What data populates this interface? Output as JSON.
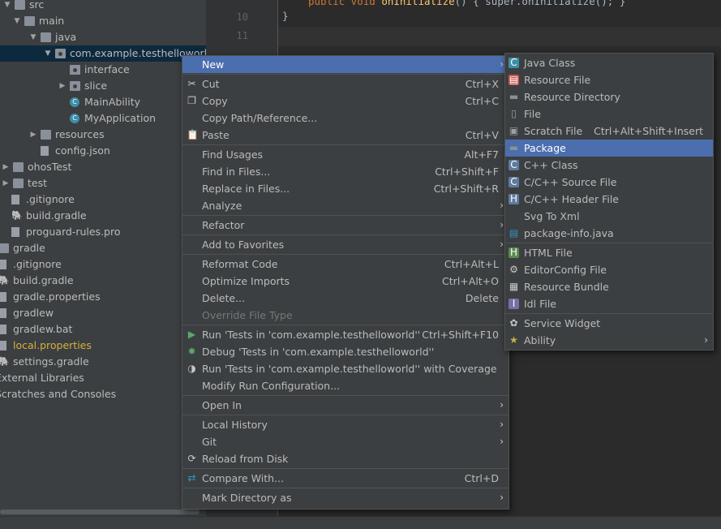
{
  "tree": {
    "items": [
      {
        "label": "src",
        "icon": "folder-icon",
        "arrow": "down"
      },
      {
        "label": "main",
        "icon": "folder-icon",
        "arrow": "down"
      },
      {
        "label": "java",
        "icon": "folder-icon",
        "arrow": "down"
      },
      {
        "label": "com.example.testhelloworld",
        "icon": "package-icon",
        "arrow": "down",
        "selected": true
      },
      {
        "label": "interface",
        "icon": "package-icon",
        "arrow": ""
      },
      {
        "label": "slice",
        "icon": "package-icon",
        "arrow": "right"
      },
      {
        "label": "MainAbility",
        "icon": "class-icon",
        "arrow": ""
      },
      {
        "label": "MyApplication",
        "icon": "class-icon",
        "arrow": ""
      },
      {
        "label": "resources",
        "icon": "folder-icon",
        "arrow": "right"
      },
      {
        "label": "config.json",
        "icon": "json-file-icon",
        "arrow": ""
      },
      {
        "label": "ohosTest",
        "icon": "folder-icon",
        "arrow": "right"
      },
      {
        "label": "test",
        "icon": "folder-icon",
        "arrow": "right"
      },
      {
        "label": ".gitignore",
        "icon": "gitignore-file-icon",
        "arrow": ""
      },
      {
        "label": "build.gradle",
        "icon": "gradle-icon",
        "arrow": ""
      },
      {
        "label": "proguard-rules.pro",
        "icon": "file-icon",
        "arrow": ""
      },
      {
        "label": "gradle",
        "icon": "folder-icon",
        "arrow": "right"
      },
      {
        "label": ".gitignore",
        "icon": "gitignore-file-icon",
        "arrow": ""
      },
      {
        "label": "build.gradle",
        "icon": "gradle-icon",
        "arrow": ""
      },
      {
        "label": "gradle.properties",
        "icon": "properties-file-icon",
        "arrow": ""
      },
      {
        "label": "gradlew",
        "icon": "file-icon",
        "arrow": ""
      },
      {
        "label": "gradlew.bat",
        "icon": "file-icon",
        "arrow": ""
      },
      {
        "label": "local.properties",
        "icon": "properties-file-icon",
        "arrow": "",
        "warn": true
      },
      {
        "label": "settings.gradle",
        "icon": "gradle-icon",
        "arrow": ""
      },
      {
        "label": "External Libraries",
        "icon": "library-icon",
        "arrow": "right"
      },
      {
        "label": "Scratches and Consoles",
        "icon": "scratch-icon",
        "arrow": "right"
      }
    ]
  },
  "editor": {
    "line_numbers": [
      "10",
      "11"
    ],
    "line_top_kw": "public void",
    "line_top_fn": "onInitialize",
    "line_top_rest": "() { super.onInitialize(); }",
    "line10": "}"
  },
  "context_menu": {
    "items": [
      {
        "label": "New",
        "shortcut": "",
        "submenu": true,
        "highlighted": true,
        "icon": ""
      },
      {
        "label": "Cut",
        "shortcut": "Ctrl+X",
        "icon": "cut-icon"
      },
      {
        "label": "Copy",
        "shortcut": "Ctrl+C",
        "icon": "copy-icon"
      },
      {
        "label": "Copy Path/Reference...",
        "shortcut": "",
        "icon": ""
      },
      {
        "label": "Paste",
        "shortcut": "Ctrl+V",
        "icon": "paste-icon"
      },
      {
        "label": "Find Usages",
        "shortcut": "Alt+F7",
        "icon": ""
      },
      {
        "label": "Find in Files...",
        "shortcut": "Ctrl+Shift+F",
        "icon": ""
      },
      {
        "label": "Replace in Files...",
        "shortcut": "Ctrl+Shift+R",
        "icon": ""
      },
      {
        "label": "Analyze",
        "shortcut": "",
        "submenu": true,
        "icon": ""
      },
      {
        "label": "Refactor",
        "shortcut": "",
        "submenu": true,
        "icon": ""
      },
      {
        "label": "Add to Favorites",
        "shortcut": "",
        "submenu": true,
        "icon": ""
      },
      {
        "label": "Reformat Code",
        "shortcut": "Ctrl+Alt+L",
        "icon": ""
      },
      {
        "label": "Optimize Imports",
        "shortcut": "Ctrl+Alt+O",
        "icon": ""
      },
      {
        "label": "Delete...",
        "shortcut": "Delete",
        "icon": ""
      },
      {
        "label": "Override File Type",
        "shortcut": "",
        "disabled": true,
        "icon": ""
      },
      {
        "label": "Run 'Tests in 'com.example.testhelloworld''",
        "shortcut": "Ctrl+Shift+F10",
        "icon": "run-icon"
      },
      {
        "label": "Debug 'Tests in 'com.example.testhelloworld''",
        "shortcut": "",
        "icon": "debug-icon"
      },
      {
        "label": "Run 'Tests in 'com.example.testhelloworld'' with Coverage",
        "shortcut": "",
        "icon": "coverage-icon"
      },
      {
        "label": "Modify Run Configuration...",
        "shortcut": "",
        "icon": ""
      },
      {
        "label": "Open In",
        "shortcut": "",
        "submenu": true,
        "icon": ""
      },
      {
        "label": "Local History",
        "shortcut": "",
        "submenu": true,
        "icon": ""
      },
      {
        "label": "Git",
        "shortcut": "",
        "submenu": true,
        "icon": ""
      },
      {
        "label": "Reload from Disk",
        "shortcut": "",
        "icon": "reload-icon"
      },
      {
        "label": "Compare With...",
        "shortcut": "Ctrl+D",
        "icon": "compare-icon"
      },
      {
        "label": "Mark Directory as",
        "shortcut": "",
        "submenu": true,
        "icon": ""
      }
    ]
  },
  "new_submenu": {
    "items": [
      {
        "label": "Java Class",
        "shortcut": "",
        "icon": "java-class-icon"
      },
      {
        "label": "Resource File",
        "shortcut": "",
        "icon": "resource-file-icon"
      },
      {
        "label": "Resource Directory",
        "shortcut": "",
        "icon": "folder-icon"
      },
      {
        "label": "File",
        "shortcut": "",
        "icon": "file-icon"
      },
      {
        "label": "Scratch File",
        "shortcut": "Ctrl+Alt+Shift+Insert",
        "icon": "scratch-file-icon"
      },
      {
        "label": "Package",
        "shortcut": "",
        "icon": "package-icon",
        "highlighted": true
      },
      {
        "label": "C++ Class",
        "shortcut": "",
        "icon": "cpp-class-icon"
      },
      {
        "label": "C/C++ Source File",
        "shortcut": "",
        "icon": "cpp-source-icon"
      },
      {
        "label": "C/C++ Header File",
        "shortcut": "",
        "icon": "cpp-header-icon"
      },
      {
        "label": "Svg To Xml",
        "shortcut": "",
        "icon": ""
      },
      {
        "label": "package-info.java",
        "shortcut": "",
        "icon": "package-info-icon"
      },
      {
        "label": "HTML File",
        "shortcut": "",
        "icon": "html-file-icon"
      },
      {
        "label": "EditorConfig File",
        "shortcut": "",
        "icon": "editorconfig-icon"
      },
      {
        "label": "Resource Bundle",
        "shortcut": "",
        "icon": "resource-bundle-icon"
      },
      {
        "label": "Idl File",
        "shortcut": "",
        "icon": "idl-file-icon"
      },
      {
        "label": "Service Widget",
        "shortcut": "",
        "icon": "service-widget-icon"
      },
      {
        "label": "Ability",
        "shortcut": "",
        "submenu": true,
        "icon": "ability-icon"
      }
    ]
  },
  "colors": {
    "highlight": "#4b6eaf",
    "panel": "#3c3f41",
    "editor": "#2b2b2b",
    "warning_text": "#d2b33a"
  }
}
